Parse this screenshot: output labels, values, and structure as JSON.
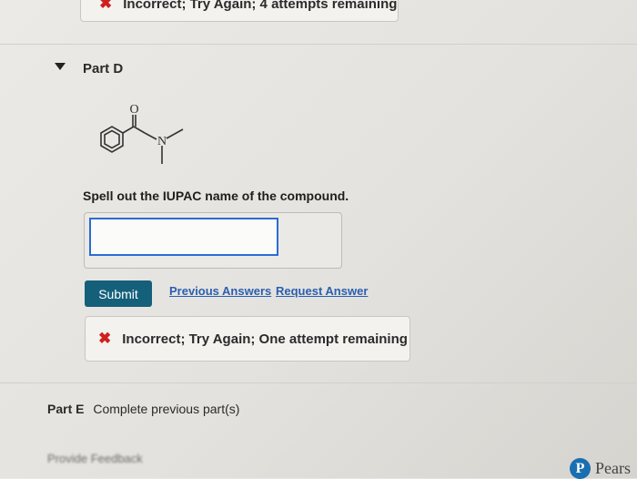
{
  "previous_feedback": {
    "icon": "x-icon",
    "text": "Incorrect; Try Again; 4 attempts remaining"
  },
  "part_d": {
    "title": "Part D",
    "structure_labels": {
      "oxygen": "O",
      "nitrogen": "N"
    },
    "question": "Spell out the IUPAC name of the compound.",
    "answer": {
      "value": "",
      "placeholder": ""
    },
    "submit_label": "Submit",
    "previous_answers_label": "Previous Answers",
    "request_answer_label": "Request Answer",
    "feedback": {
      "icon": "x-icon",
      "text": "Incorrect; Try Again; One attempt remaining",
      "color": "#d11e1e"
    }
  },
  "part_e": {
    "label": "Part E",
    "text": "Complete previous part(s)"
  },
  "footer": {
    "provide_feedback": "Provide Feedback",
    "brand_logo": "P",
    "brand_name": "Pears"
  },
  "colors": {
    "submit": "#14607a",
    "link": "#2a5fb0",
    "input_border": "#2b6cd4",
    "error": "#d11e1e"
  }
}
